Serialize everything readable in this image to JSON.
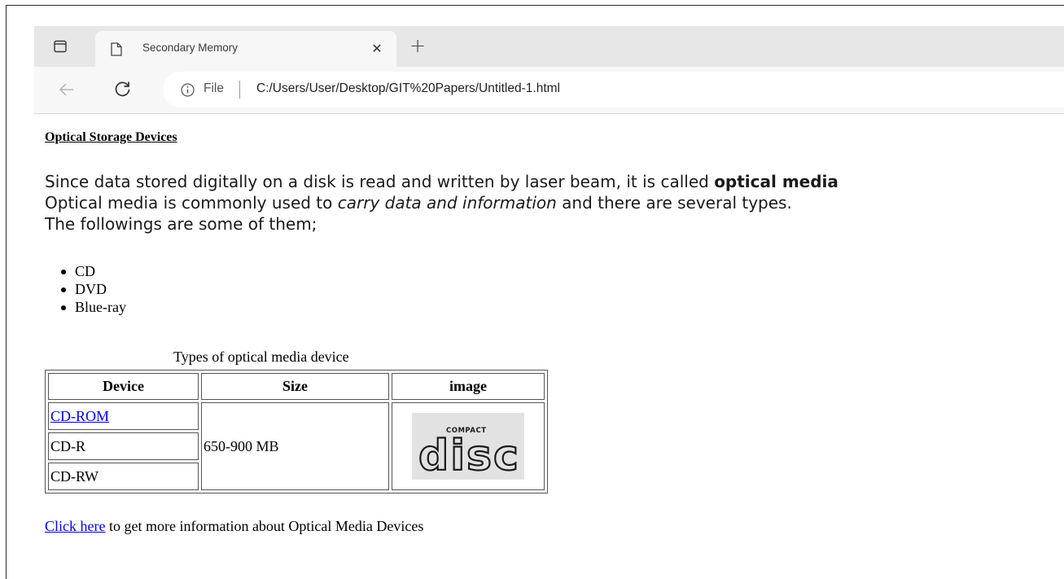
{
  "browser": {
    "tab": {
      "title": "Secondary Memory"
    },
    "address": {
      "scheme_label": "File",
      "url": "C:/Users/User/Desktop/GIT%20Papers/Untitled-1.html"
    }
  },
  "page": {
    "heading": "Optical Storage Devices",
    "paragraph": {
      "line1_text": "Since data stored digitally on a disk is read and written by laser beam, it is called ",
      "line1_bold": "optical media",
      "line2_before": "Optical media is commonly used to ",
      "line2_italic": "carry data and information",
      "line2_after": " and there are several types.",
      "line3": "The followings are some of them;"
    },
    "list": [
      "CD",
      "DVD",
      "Blue-ray"
    ],
    "table": {
      "caption": "Types of optical media device",
      "headers": [
        "Device",
        "Size",
        "image"
      ],
      "devices": [
        "CD-ROM",
        "CD-R",
        "CD-RW"
      ],
      "size": "650-900 MB",
      "image_logo_text": {
        "top": "COMPACT",
        "main": "disc"
      }
    },
    "footer": {
      "link": "Click here",
      "text": " to get more information about Optical Media Devices"
    }
  }
}
